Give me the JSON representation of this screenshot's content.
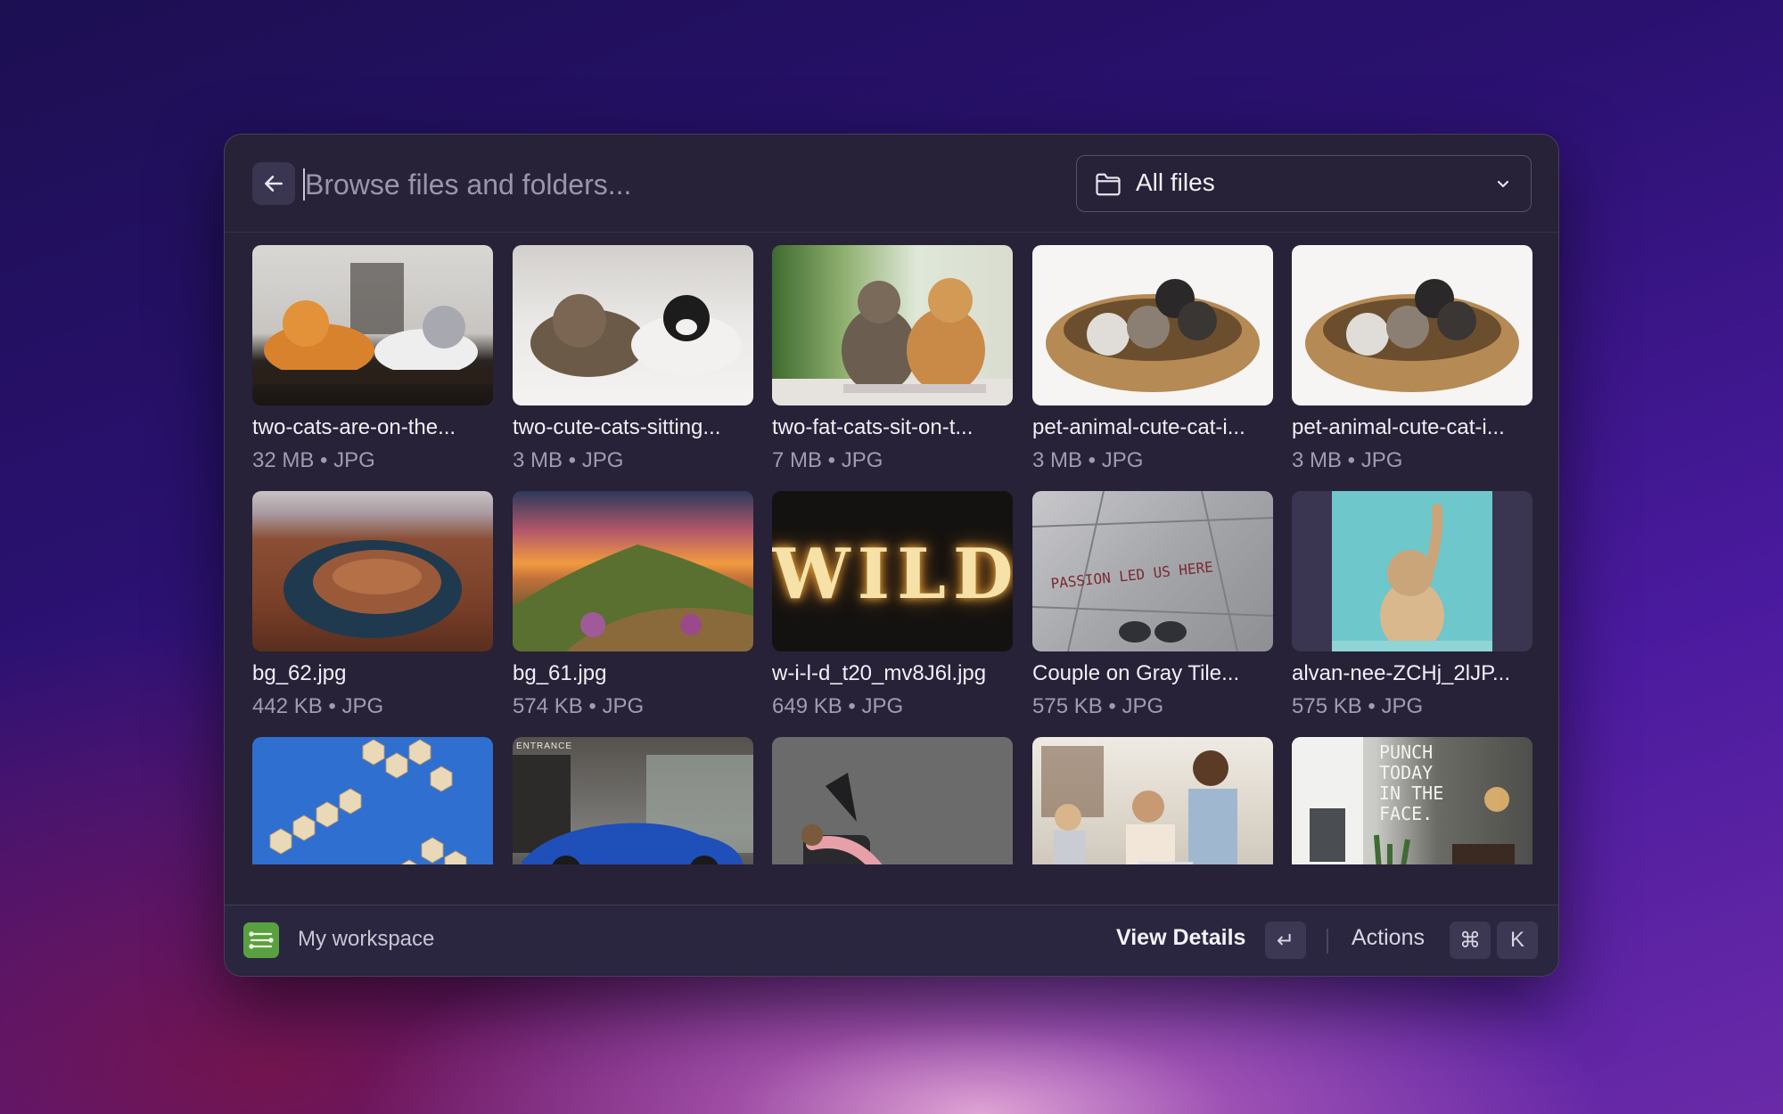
{
  "search": {
    "placeholder": "Browse files and folders..."
  },
  "filter": {
    "selected": "All files"
  },
  "files": [
    {
      "name": "two-cats-are-on-the...",
      "meta": "32 MB • JPG"
    },
    {
      "name": "two-cute-cats-sitting...",
      "meta": "3 MB • JPG"
    },
    {
      "name": "two-fat-cats-sit-on-t...",
      "meta": "7 MB • JPG"
    },
    {
      "name": "pet-animal-cute-cat-i...",
      "meta": "3 MB • JPG"
    },
    {
      "name": "pet-animal-cute-cat-i...",
      "meta": "3 MB • JPG"
    },
    {
      "name": "bg_62.jpg",
      "meta": "442 KB • JPG"
    },
    {
      "name": "bg_61.jpg",
      "meta": "574 KB • JPG"
    },
    {
      "name": "w-i-l-d_t20_mv8J6l.jpg",
      "meta": "649 KB • JPG"
    },
    {
      "name": "Couple on Gray Tile...",
      "meta": "575 KB • JPG"
    },
    {
      "name": "alvan-nee-ZCHj_2lJP...",
      "meta": "575 KB • JPG"
    }
  ],
  "thumb_text": {
    "wild": "WILD",
    "passion": "PASSION LED US HERE",
    "entrance": "ENTRANCE",
    "punch": "PUNCH TODAY IN THE FACE."
  },
  "footer": {
    "workspace": "My workspace",
    "view_details": "View Details",
    "enter_key": "↵",
    "actions": "Actions",
    "cmd_key": "⌘",
    "k_key": "K"
  },
  "colors": {
    "window_bg": "#272238",
    "workspace_icon": "#5aa040"
  }
}
